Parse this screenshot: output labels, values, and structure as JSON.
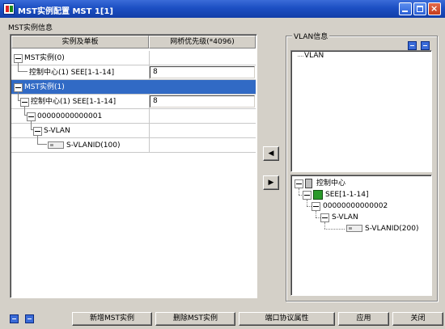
{
  "window": {
    "title": "MST实例配置  MST 1[1]"
  },
  "section_left": {
    "title": "MST实例信息"
  },
  "table": {
    "headers": [
      "实例及单板",
      "网桥优先级(*4096)"
    ],
    "rows": [
      {
        "label": "MST实例(0)",
        "value": ""
      },
      {
        "label": "控制中心(1)  SEE[1-1-14]",
        "value": "8"
      },
      {
        "label": "MST实例(1)",
        "value": ""
      },
      {
        "label": "控制中心(1)  SEE[1-1-14]",
        "value": "8"
      },
      {
        "label": "00000000000001",
        "value": ""
      },
      {
        "label": "S-VLAN",
        "value": ""
      },
      {
        "label": "S-VLANID(100)",
        "value": ""
      }
    ]
  },
  "vlan_panel": {
    "title": "VLAN信息",
    "top_tree": [
      "VLAN"
    ],
    "bottom_tree": [
      "控制中心",
      "SEE[1-1-14]",
      "00000000000002",
      "S-VLAN",
      "S-VLANID(200)"
    ]
  },
  "arrows": {
    "left": "◀",
    "right": "▶"
  },
  "buttons": {
    "add": "新增MST实例",
    "delete": "删除MST实例",
    "port": "端口协议属性",
    "apply": "应用",
    "close": "关闭"
  },
  "colors": {
    "titlebar": "#1c4fc3",
    "selection": "#316ac5",
    "face": "#d4d0c8"
  }
}
